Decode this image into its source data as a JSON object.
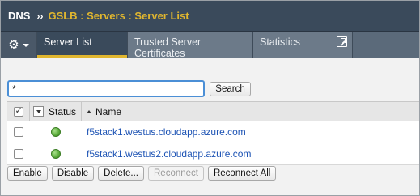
{
  "breadcrumb": {
    "root": "DNS",
    "separator": "››",
    "path": "GSLB : Servers : Server List"
  },
  "tabs": [
    {
      "label": "Server List",
      "active": true
    },
    {
      "label": "Trusted Server Certificates",
      "active": false
    },
    {
      "label": "Statistics",
      "active": false
    }
  ],
  "search": {
    "value": "*",
    "button_label": "Search"
  },
  "table": {
    "columns": {
      "status": "Status",
      "name": "Name"
    },
    "rows": [
      {
        "status": "available",
        "name": "f5stack1.westus.cloudapp.azure.com"
      },
      {
        "status": "available",
        "name": "f5stack1.westus2.cloudapp.azure.com"
      }
    ]
  },
  "actions": {
    "enable": "Enable",
    "disable": "Disable",
    "delete": "Delete...",
    "reconnect": "Reconnect",
    "reconnect_all": "Reconnect All"
  },
  "colors": {
    "header_bg": "#3a4a5b",
    "breadcrumb_path": "#e0b62f",
    "link": "#1f55b5",
    "status_available": "#5aab3a"
  },
  "icons": {
    "tab_menu": "gear-icon",
    "popout": "external-window-icon"
  }
}
